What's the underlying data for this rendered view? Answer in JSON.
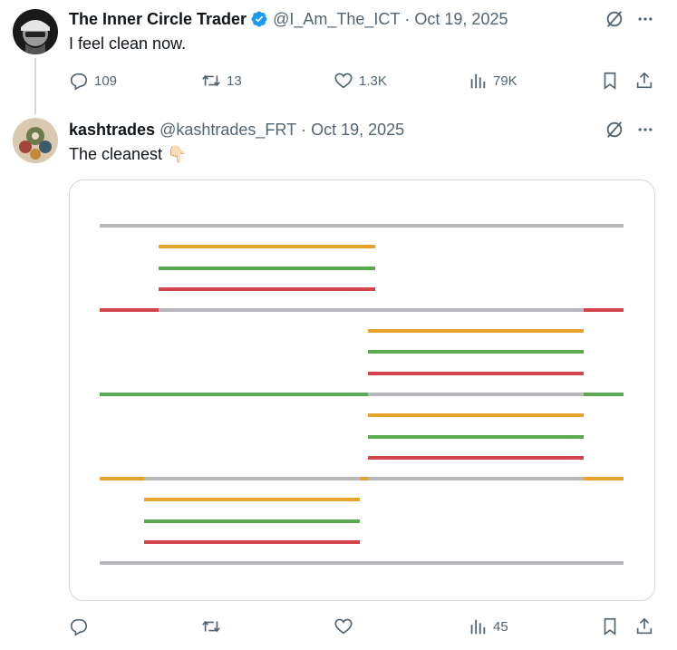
{
  "tweets": [
    {
      "author_name": "The Inner Circle Trader",
      "handle": "@I_Am_The_ICT",
      "separator": "·",
      "date": "Oct 19, 2025",
      "text": "I feel clean now.",
      "verified": true,
      "actions": {
        "reply_count": "109",
        "retweet_count": "13",
        "like_count": "1.3K",
        "views_count": "79K"
      }
    },
    {
      "author_name": "kashtrades",
      "handle": "@kashtrades_FRT",
      "separator": "·",
      "date": "Oct 19, 2025",
      "text": "The cleanest",
      "emoji": "👇🏻",
      "actions": {
        "reply_count": "",
        "retweet_count": "",
        "like_count": "",
        "views_count": "45"
      }
    }
  ],
  "icons": [
    "grok-icon",
    "more-icon",
    "reply-icon",
    "retweet-icon",
    "like-icon",
    "views-icon",
    "bookmark-icon",
    "share-icon",
    "verified-badge-icon"
  ],
  "colors": {
    "text_primary": "#0f1419",
    "text_secondary": "#536471",
    "verified_blue": "#1d9bf0",
    "border": "#cfd9de",
    "line_gray": "#b8b8bc",
    "line_orange": "#e8a32e",
    "line_green": "#5aaa52",
    "line_red": "#d2434c"
  }
}
